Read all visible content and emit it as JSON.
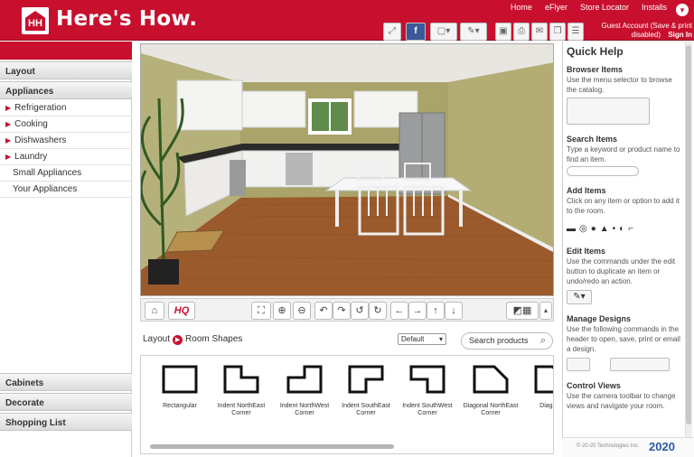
{
  "header": {
    "brand": "Here's How.",
    "logo_text": "HH",
    "links": [
      "Home",
      "eFlyer",
      "Store Locator",
      "Installs"
    ],
    "account": "Guest Account (Save & print disabled)",
    "sign_in": "Sign In"
  },
  "sidebar": {
    "sections": [
      "Layout",
      "Appliances"
    ],
    "items": [
      {
        "label": "Refrigeration",
        "expandable": true
      },
      {
        "label": "Cooking",
        "expandable": true
      },
      {
        "label": "Dishwashers",
        "expandable": true
      },
      {
        "label": "Laundry",
        "expandable": true
      },
      {
        "label": "Small Appliances",
        "expandable": false
      },
      {
        "label": "Your Appliances",
        "expandable": false
      }
    ],
    "bottom_sections": [
      "Cabinets",
      "Decorate",
      "Shopping List"
    ]
  },
  "viewbar": {
    "hq_label": "HQ"
  },
  "catalog": {
    "breadcrumb_root": "Layout",
    "breadcrumb_current": "Room Shapes",
    "sort_value": "Default",
    "search_placeholder": "Search products",
    "tiles": [
      {
        "line1": "Rectangular",
        "line2": ""
      },
      {
        "line1": "Indent NorthEast",
        "line2": "Corner"
      },
      {
        "line1": "Indent NorthWest",
        "line2": "Corner"
      },
      {
        "line1": "Indent SouthEast",
        "line2": "Corner"
      },
      {
        "line1": "Indent SouthWest",
        "line2": "Corner"
      },
      {
        "line1": "Diagonal NorthEast",
        "line2": "Corner"
      },
      {
        "line1": "Diagonal",
        "line2": ""
      }
    ]
  },
  "quick_help": {
    "title": "Quick Help",
    "sections": [
      {
        "title": "Browser Items",
        "desc": "Use the menu selector to browse the catalog."
      },
      {
        "title": "Search Items",
        "desc": "Type a keyword or product name to find an item."
      },
      {
        "title": "Add Items",
        "desc": "Click on any item or option to add it to the room."
      },
      {
        "title": "Edit Items",
        "desc": "Use the commands under the edit button to duplicate an item or undo/redo an action."
      },
      {
        "title": "Manage Designs",
        "desc": "Use the following commands in the header to open, save, print or email a design."
      },
      {
        "title": "Control Views",
        "desc": "Use the camera toolbar to change views and navigate your room."
      }
    ],
    "copyright": "© 20-20 Technologies Inc.",
    "vendor": "2020"
  },
  "colors": {
    "brand_red": "#c8102e",
    "wall": "#a9a36c",
    "floor": "#9b5a2c"
  }
}
